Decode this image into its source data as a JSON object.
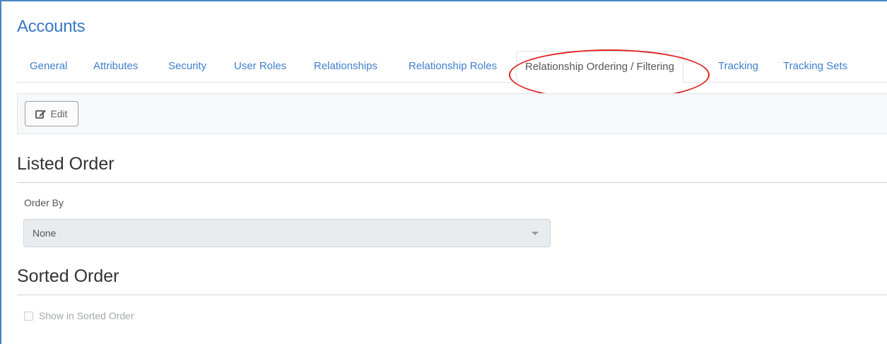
{
  "page": {
    "title": "Accounts"
  },
  "tabs": [
    {
      "label": "General"
    },
    {
      "label": "Attributes"
    },
    {
      "label": "Security"
    },
    {
      "label": "User Roles"
    },
    {
      "label": "Relationships"
    },
    {
      "label": "Relationship Roles"
    },
    {
      "label": "Relationship Ordering / Filtering",
      "active": true
    },
    {
      "label": "Tracking"
    },
    {
      "label": "Tracking Sets"
    }
  ],
  "toolbar": {
    "edit_label": "Edit",
    "edit_icon": "edit-icon"
  },
  "listed_order": {
    "heading": "Listed Order",
    "order_by_label": "Order By",
    "order_by_value": "None"
  },
  "sorted_order": {
    "heading": "Sorted Order",
    "show_sorted_label": "Show in Sorted Order",
    "show_sorted_checked": false
  },
  "colors": {
    "accent": "#3a78c3",
    "highlight_ring": "#e02020"
  }
}
